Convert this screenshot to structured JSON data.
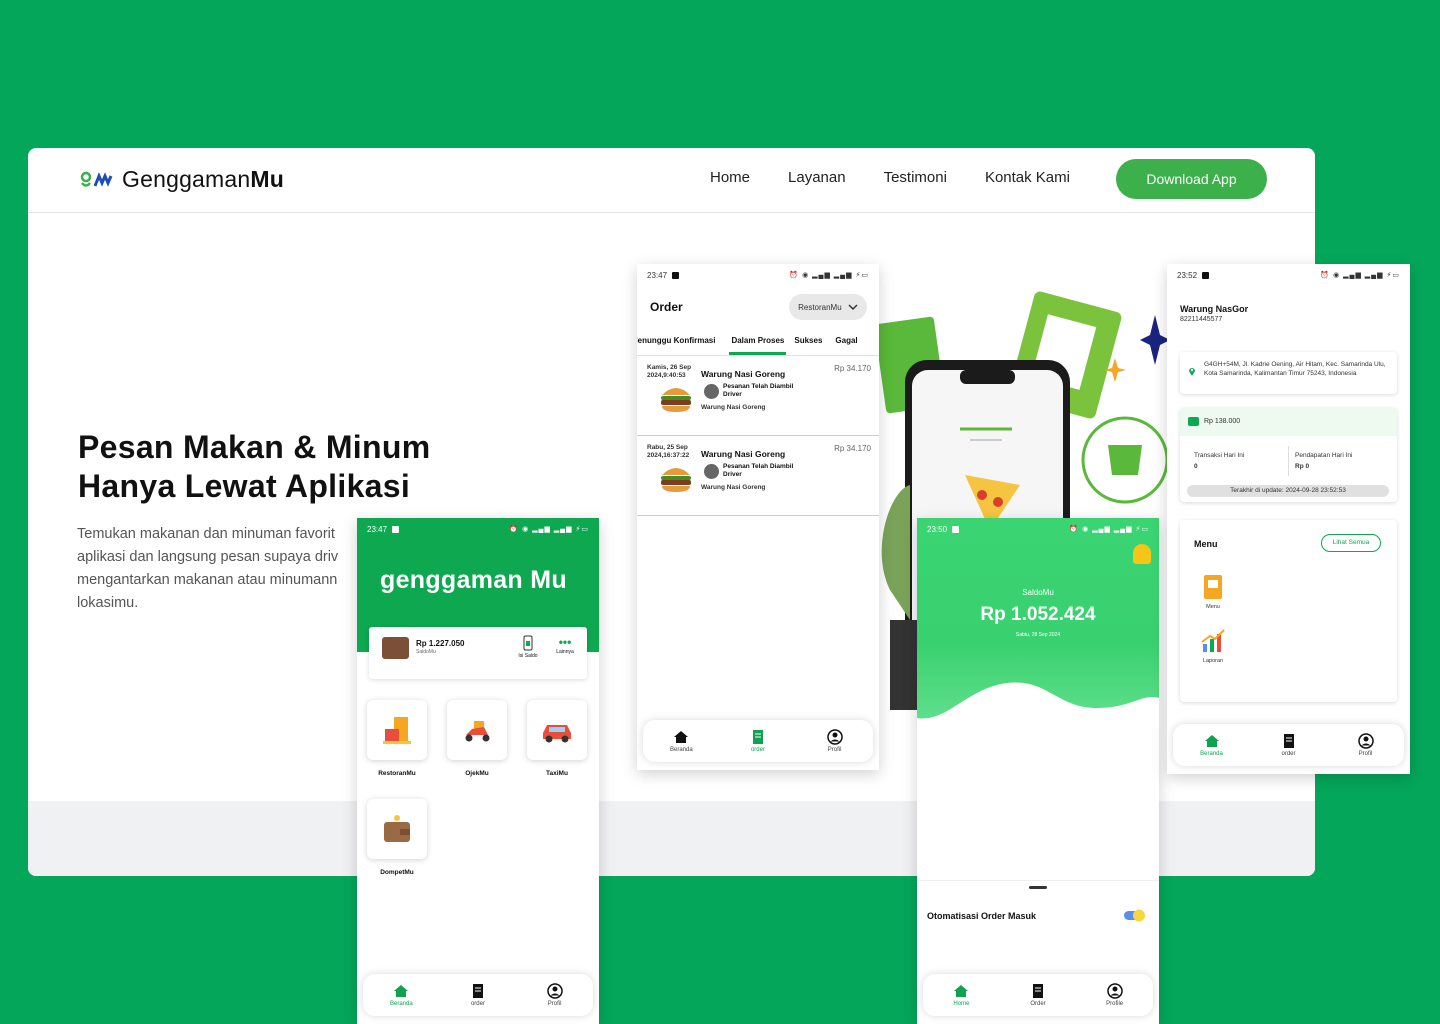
{
  "site": {
    "brand": "GenggamanMu",
    "brand_plain": "Genggaman",
    "brand_bold": "Mu",
    "nav": [
      "Home",
      "Layanan",
      "Testimoni",
      "Kontak Kami"
    ],
    "download_label": "Download App",
    "hero_title_line1": "Pesan Makan & Minum",
    "hero_title_line2": "Hanya Lewat Aplikasi",
    "hero_desc_lines": [
      "Temukan makanan dan minuman favorit",
      "aplikasi dan langsung pesan supaya driv",
      "mengantarkan makanan atau minumann",
      "lokasimu."
    ]
  },
  "order_phone": {
    "time": "23:47",
    "title": "Order",
    "resto_select": "RestoranMu",
    "tabs": [
      "Menunggu Konfirmasi",
      "Dalam Proses",
      "Sukses",
      "Gagal"
    ],
    "active_tab": "Dalam Proses",
    "orders": [
      {
        "date1": "Kamis, 26 Sep",
        "date2": "2024,9:40:53",
        "name": "Warung Nasi Goreng",
        "price": "Rp 34.170",
        "status": "Pesanan Telah Diambil Driver",
        "sub": "Warung Nasi Goreng"
      },
      {
        "date1": "Rabu, 25 Sep",
        "date2": "2024,16:37:22",
        "name": "Warung Nasi Goreng",
        "price": "Rp 34.170",
        "status": "Pesanan Telah Diambil Driver",
        "sub": "Warung Nasi Goreng"
      }
    ],
    "nav": [
      "Beranda",
      "order",
      "Profil"
    ]
  },
  "home_phone": {
    "time": "23:47",
    "logo": "genggaman Mu",
    "saldo_amount": "Rp 1.227.050",
    "saldo_label": "SaldoMu",
    "isi_saldo": "Isi Saldo",
    "lainnya": "Lainnya",
    "services": [
      "RestoranMu",
      "OjekMu",
      "TaxiMu",
      "DompetMu"
    ],
    "nav": [
      "Beranda",
      "order",
      "Profil"
    ]
  },
  "saldo_phone": {
    "time": "23:50",
    "title": "SaldoMu",
    "amount": "Rp 1.052.424",
    "date": "Sabtu, 28 Sep 2024",
    "auto_order": "Otomatisasi Order Masuk",
    "nav": [
      "Home",
      "Order",
      "Profile"
    ]
  },
  "merchant_phone": {
    "time": "23:52",
    "name": "Warung NasGor",
    "phone": "82211445577",
    "address": "G4GH+54M, Jl. Kadrie Oening, Air Hitam, Kec. Samarinda Ulu, Kota Samarinda, Kalimantan Timur 75243, Indonesia",
    "balance": "Rp 138.000",
    "transaksi_label": "Transaksi Hari Ini",
    "transaksi_value": "0",
    "pendapatan_label": "Pendapatan Hari Ini",
    "pendapatan_value": "Rp 0",
    "last_update": "Terakhir di update: 2024-09-28 23:52:53",
    "menu_title": "Menu",
    "lihat_semua": "Lihat Semua",
    "menu_items": [
      "Menu",
      "Laporan"
    ],
    "nav": [
      "Beranda",
      "order",
      "Profil"
    ]
  },
  "colors": {
    "background": "#04a65a",
    "brand_green": "#0ea850",
    "button_green": "#3bb04b"
  }
}
